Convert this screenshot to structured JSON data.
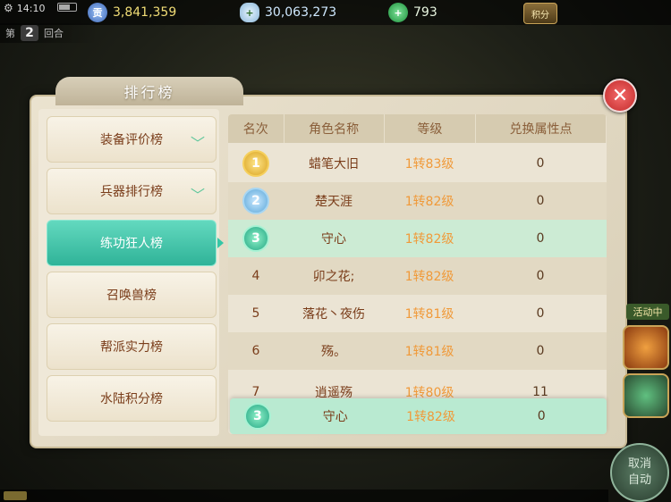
{
  "status": {
    "time": "14:10"
  },
  "resources": {
    "copper": "3,841,359",
    "silver": "30,063,273",
    "jade": "793",
    "copper_icon": "贡",
    "plus": "+",
    "score_button": "积分"
  },
  "round": {
    "prefix": "第",
    "number": "2",
    "suffix": "回合"
  },
  "panel": {
    "title": "排行榜",
    "close": "✕"
  },
  "tabs": [
    {
      "label": "装备评价榜",
      "chevron": "﹀"
    },
    {
      "label": "兵器排行榜",
      "chevron": "﹀"
    },
    {
      "label": "练功狂人榜"
    },
    {
      "label": "召唤兽榜"
    },
    {
      "label": "帮派实力榜"
    },
    {
      "label": "水陆积分榜"
    }
  ],
  "table": {
    "headers": [
      "名次",
      "角色名称",
      "等级",
      "兑换属性点"
    ],
    "rows": [
      {
        "rank": "1",
        "name": "蜡笔大旧",
        "level": "1转83级",
        "points": "0"
      },
      {
        "rank": "2",
        "name": "楚天涯",
        "level": "1转82级",
        "points": "0"
      },
      {
        "rank": "3",
        "name": "守心",
        "level": "1转82级",
        "points": "0"
      },
      {
        "rank": "4",
        "name": "卯之花;",
        "level": "1转82级",
        "points": "0"
      },
      {
        "rank": "5",
        "name": "落花丶夜伤",
        "level": "1转81级",
        "points": "0"
      },
      {
        "rank": "6",
        "name": "殇。",
        "level": "1转81级",
        "points": "0"
      },
      {
        "rank": "7",
        "name": "逍遥殇",
        "level": "1转80级",
        "points": "11"
      }
    ],
    "my_rank": {
      "rank": "3",
      "name": "守心",
      "level": "1转82级",
      "points": "0"
    }
  },
  "side": {
    "event_label": "活动中",
    "auto_line1": "取消",
    "auto_line2": "自动"
  }
}
